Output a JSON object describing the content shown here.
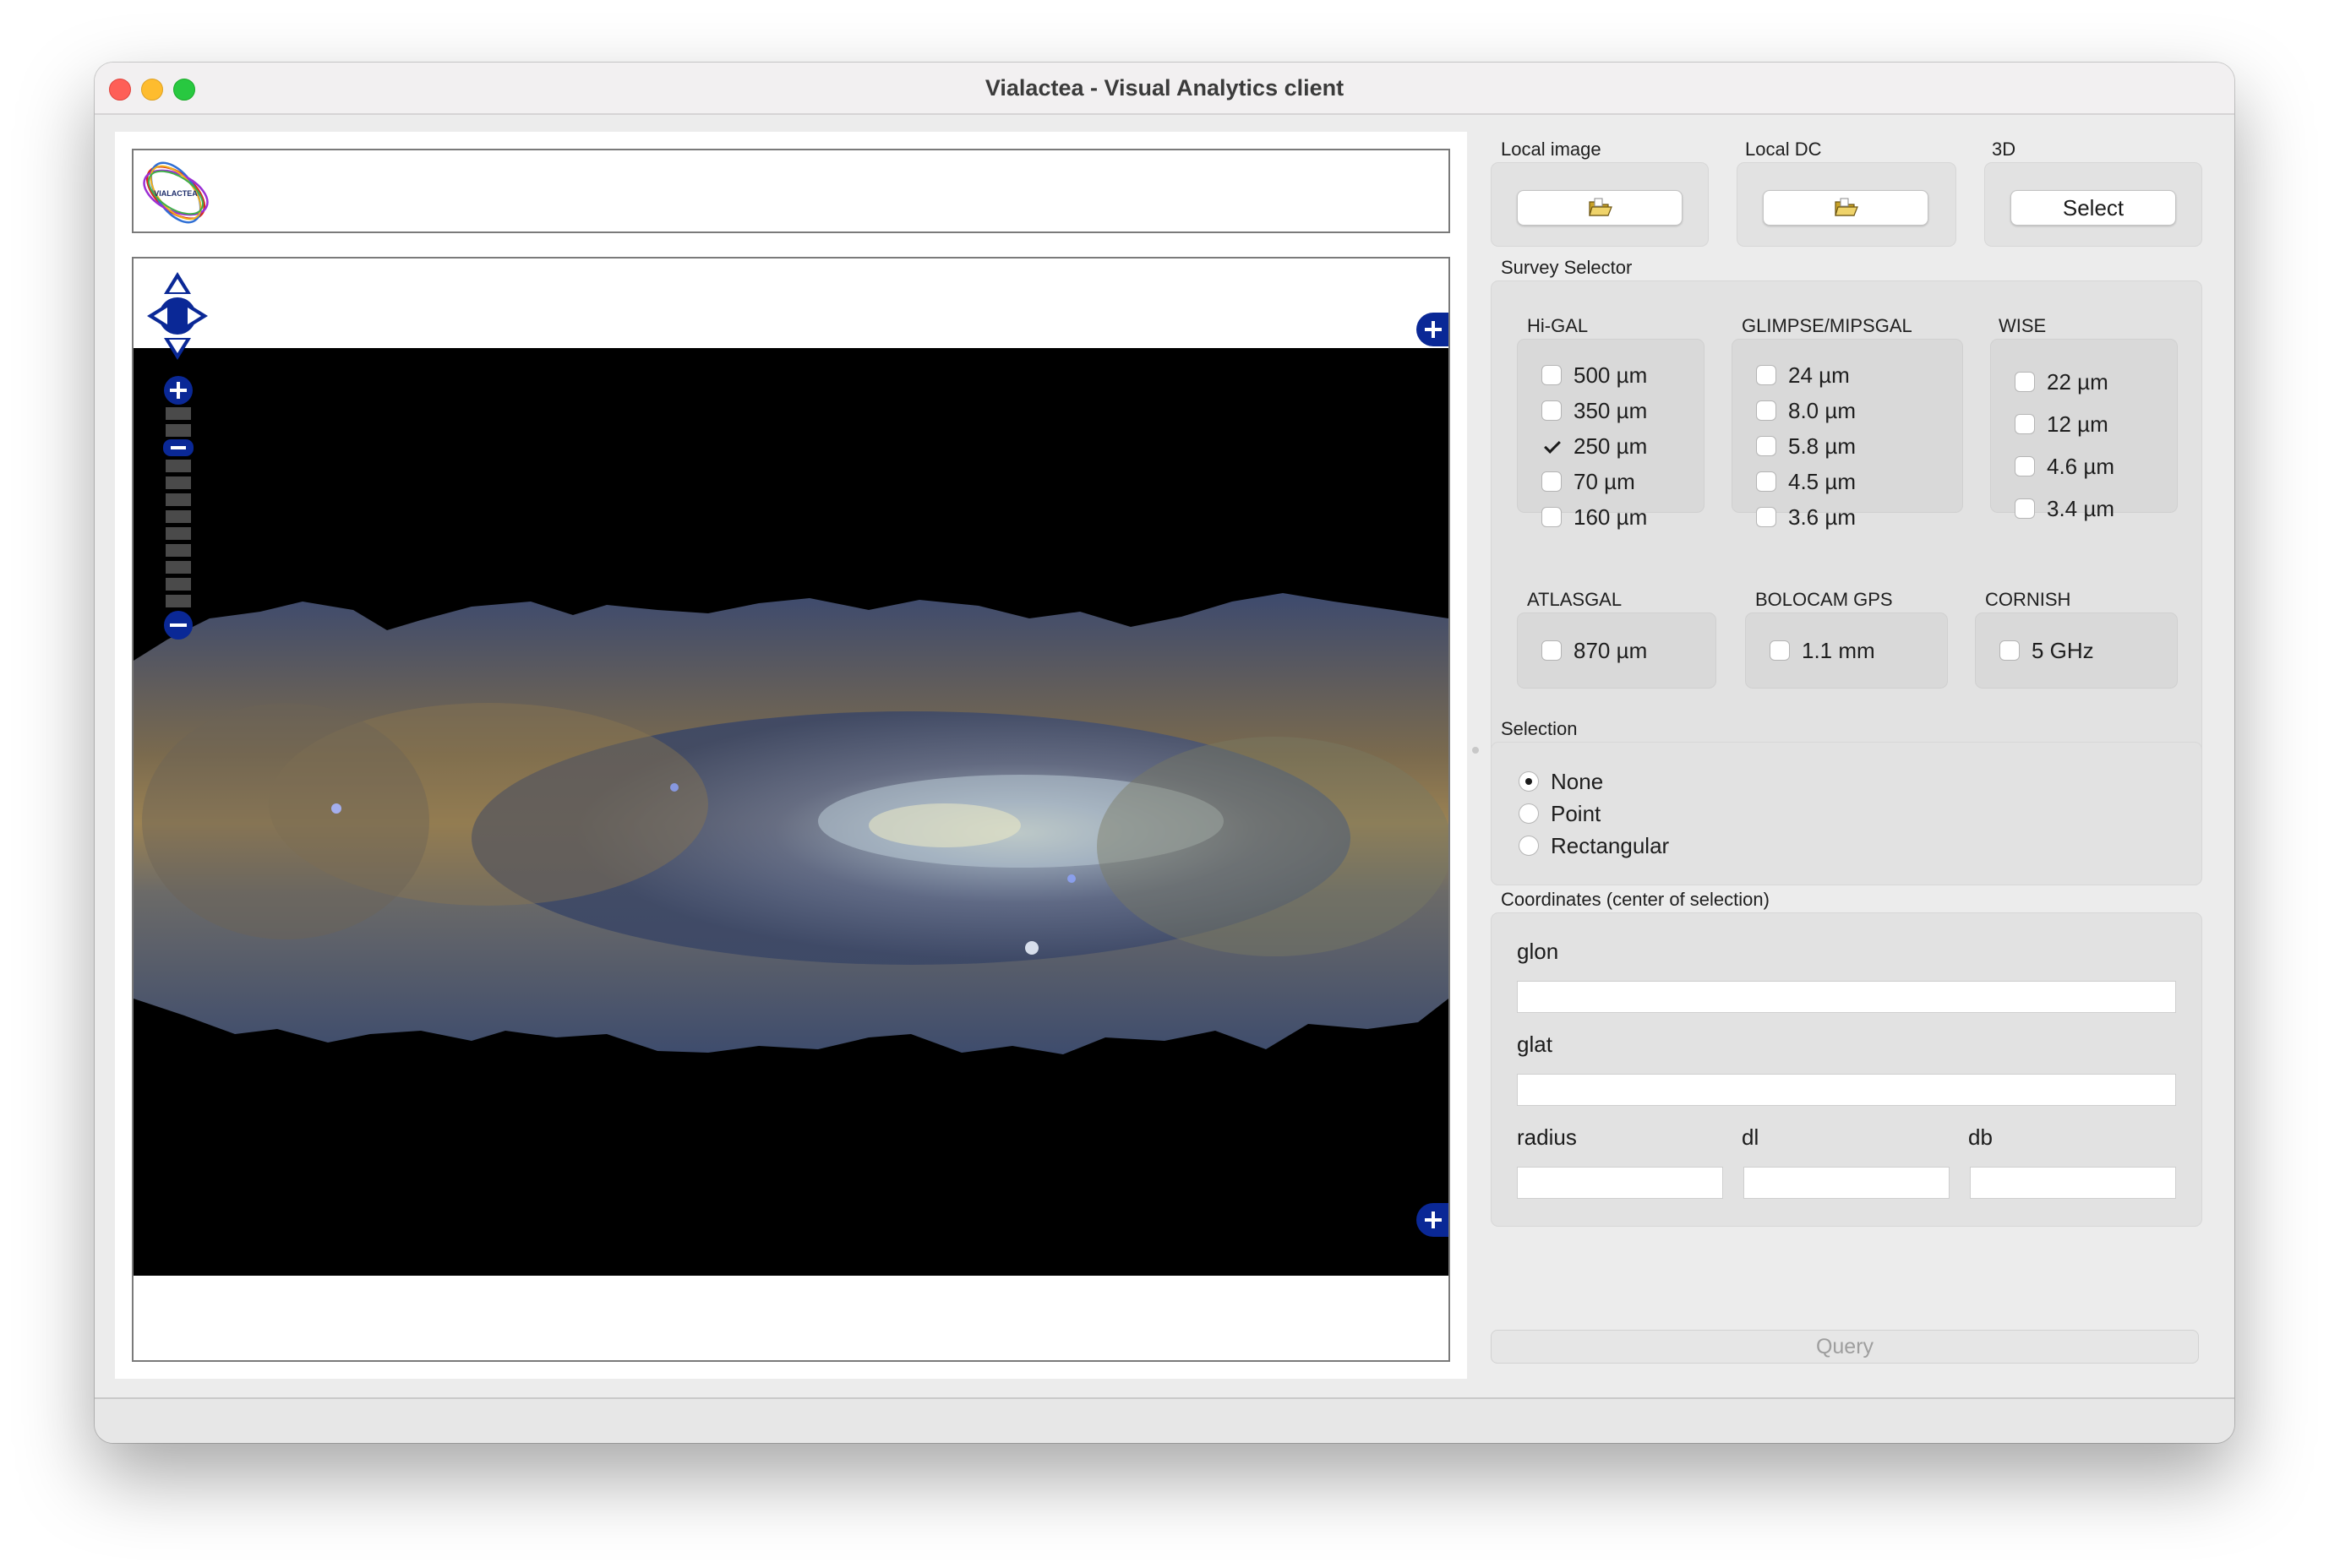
{
  "window": {
    "title": "Vialactea - Visual Analytics client"
  },
  "logo": {
    "text": "VIALACTEA"
  },
  "loaders": {
    "local_image": {
      "title": "Local image",
      "icon": "folder-open-icon"
    },
    "local_dc": {
      "title": "Local DC",
      "icon": "folder-open-icon"
    },
    "three_d": {
      "title": "3D",
      "button_label": "Select"
    }
  },
  "survey": {
    "title": "Survey Selector",
    "higal": {
      "title": "Hi-GAL",
      "items": [
        {
          "label": "500 µm",
          "checked": false
        },
        {
          "label": "350 µm",
          "checked": false
        },
        {
          "label": "250 µm",
          "checked": true
        },
        {
          "label": "70 µm",
          "checked": false
        },
        {
          "label": "160 µm",
          "checked": false
        }
      ]
    },
    "glimpse": {
      "title": "GLIMPSE/MIPSGAL",
      "items": [
        {
          "label": "24 µm",
          "checked": false
        },
        {
          "label": "8.0 µm",
          "checked": false
        },
        {
          "label": "5.8 µm",
          "checked": false
        },
        {
          "label": "4.5 µm",
          "checked": false
        },
        {
          "label": "3.6 µm",
          "checked": false
        }
      ]
    },
    "wise": {
      "title": "WISE",
      "items": [
        {
          "label": "22 µm",
          "checked": false
        },
        {
          "label": "12 µm",
          "checked": false
        },
        {
          "label": "4.6 µm",
          "checked": false
        },
        {
          "label": "3.4 µm",
          "checked": false
        }
      ]
    },
    "atlasgal": {
      "title": "ATLASGAL",
      "items": [
        {
          "label": "870 µm",
          "checked": false
        }
      ]
    },
    "bolocam": {
      "title": "BOLOCAM GPS",
      "items": [
        {
          "label": "1.1 mm",
          "checked": false
        }
      ]
    },
    "cornish": {
      "title": "CORNISH",
      "items": [
        {
          "label": "5 GHz",
          "checked": false
        }
      ]
    }
  },
  "selection": {
    "title": "Selection",
    "options": [
      {
        "label": "None",
        "checked": true
      },
      {
        "label": "Point",
        "checked": false
      },
      {
        "label": "Rectangular",
        "checked": false
      }
    ]
  },
  "coordinates": {
    "title": "Coordinates (center of selection)",
    "glon_label": "glon",
    "glon_value": "",
    "glat_label": "glat",
    "glat_value": "",
    "radius_label": "radius",
    "radius_value": "",
    "dl_label": "dl",
    "dl_value": "",
    "db_label": "db",
    "db_value": ""
  },
  "query_button": {
    "label": "Query",
    "enabled": false
  },
  "colors": {
    "map_nav": "#0a2896",
    "background": "#ececec"
  }
}
